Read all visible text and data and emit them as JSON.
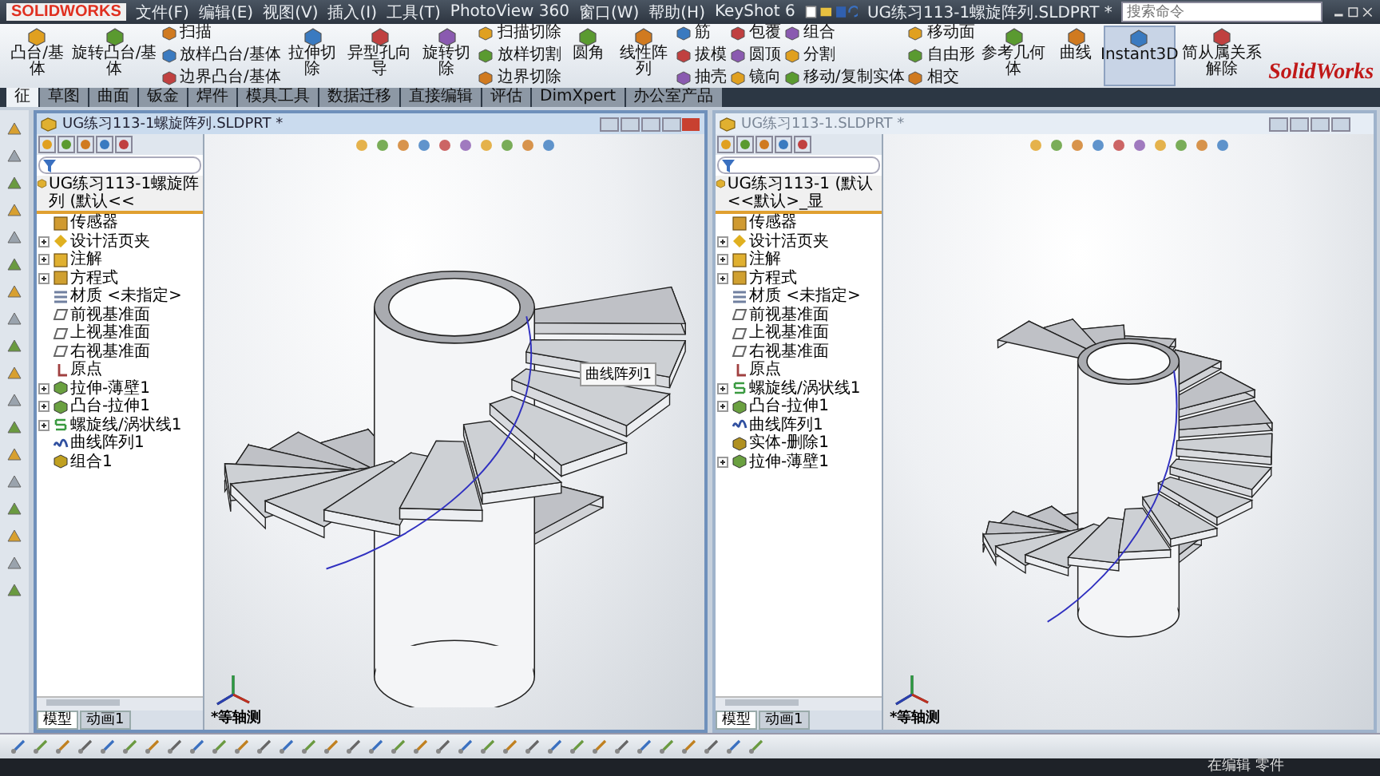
{
  "app": {
    "logo": "SOLIDWORKS",
    "title": "UG练习113-1螺旋阵列.SLDPRT *",
    "search_placeholder": "搜索命令",
    "brand": "SolidWorks"
  },
  "menu": [
    "文件(F)",
    "编辑(E)",
    "视图(V)",
    "插入(I)",
    "工具(T)",
    "PhotoView 360",
    "窗口(W)",
    "帮助(H)",
    "KeyShot 6"
  ],
  "ribbon": [
    {
      "kind": "large",
      "label": "凸台/基体"
    },
    {
      "kind": "large",
      "label": "旋转凸台/基体"
    },
    {
      "kind": "stack",
      "items": [
        "扫描",
        "放样凸台/基体",
        "边界凸台/基体"
      ]
    },
    {
      "kind": "large",
      "label": "拉伸切除"
    },
    {
      "kind": "large",
      "label": "异型孔向导"
    },
    {
      "kind": "large",
      "label": "旋转切除"
    },
    {
      "kind": "stack",
      "items": [
        "扫描切除",
        "放样切割",
        "边界切除"
      ]
    },
    {
      "kind": "large",
      "label": "圆角"
    },
    {
      "kind": "large",
      "label": "线性阵列"
    },
    {
      "kind": "stack",
      "items": [
        "筋",
        "拔模",
        "抽壳"
      ]
    },
    {
      "kind": "stack",
      "items": [
        "包覆",
        "圆顶",
        "镜向"
      ]
    },
    {
      "kind": "stack",
      "items": [
        "组合",
        "分割",
        "移动/复制实体"
      ]
    },
    {
      "kind": "stack",
      "items": [
        "移动面",
        "自由形",
        "相交"
      ]
    },
    {
      "kind": "large",
      "label": "参考几何体"
    },
    {
      "kind": "large",
      "label": "曲线"
    },
    {
      "kind": "large",
      "label": "Instant3D"
    },
    {
      "kind": "large",
      "label": "简从属关系解除"
    }
  ],
  "tabs": [
    {
      "label": "征",
      "selected": true
    },
    {
      "label": "草图",
      "selected": false
    },
    {
      "label": "曲面",
      "selected": false
    },
    {
      "label": "钣金",
      "selected": false
    },
    {
      "label": "焊件",
      "selected": false
    },
    {
      "label": "模具工具",
      "selected": false
    },
    {
      "label": "数据迁移",
      "selected": false
    },
    {
      "label": "直接编辑",
      "selected": false
    },
    {
      "label": "评估",
      "selected": false
    },
    {
      "label": "DimXpert",
      "selected": false
    },
    {
      "label": "办公室产品",
      "selected": false
    }
  ],
  "documents": [
    {
      "title": "UG练习113-1螺旋阵列.SLDPRT *",
      "active": true,
      "root": "UG练习113-1螺旋阵列 (默认<<",
      "tooltip": "曲线阵列1",
      "view_label": "*等轴测",
      "tree": [
        {
          "label": "传感器",
          "kind": "sensor",
          "collapsible": false
        },
        {
          "label": "设计活页夹",
          "kind": "binder",
          "collapsible": true
        },
        {
          "label": "注解",
          "kind": "annotation",
          "collapsible": true
        },
        {
          "label": "方程式",
          "kind": "equation",
          "collapsible": true
        },
        {
          "label": "材质 <未指定>",
          "kind": "material",
          "collapsible": false
        },
        {
          "label": "前视基准面",
          "kind": "plane",
          "collapsible": false
        },
        {
          "label": "上视基准面",
          "kind": "plane",
          "collapsible": false
        },
        {
          "label": "右视基准面",
          "kind": "plane",
          "collapsible": false
        },
        {
          "label": "原点",
          "kind": "origin",
          "collapsible": false
        },
        {
          "label": "拉伸-薄壁1",
          "kind": "feature",
          "collapsible": true
        },
        {
          "label": "凸台-拉伸1",
          "kind": "feature",
          "collapsible": true
        },
        {
          "label": "螺旋线/涡状线1",
          "kind": "helix",
          "collapsible": true
        },
        {
          "label": "曲线阵列1",
          "kind": "pattern",
          "collapsible": false
        },
        {
          "label": "组合1",
          "kind": "combine",
          "collapsible": false
        }
      ],
      "bottom_tabs": [
        {
          "label": "模型",
          "selected": true
        },
        {
          "label": "动画1",
          "selected": false
        }
      ]
    },
    {
      "title": "UG练习113-1.SLDPRT *",
      "active": false,
      "root": "UG练习113-1 (默认<<默认>_显",
      "view_label": "*等轴测",
      "tree": [
        {
          "label": "传感器",
          "kind": "sensor",
          "collapsible": false
        },
        {
          "label": "设计活页夹",
          "kind": "binder",
          "collapsible": true
        },
        {
          "label": "注解",
          "kind": "annotation",
          "collapsible": true
        },
        {
          "label": "方程式",
          "kind": "equation",
          "collapsible": true
        },
        {
          "label": "材质 <未指定>",
          "kind": "material",
          "collapsible": false
        },
        {
          "label": "前视基准面",
          "kind": "plane",
          "collapsible": false
        },
        {
          "label": "上视基准面",
          "kind": "plane",
          "collapsible": false
        },
        {
          "label": "右视基准面",
          "kind": "plane",
          "collapsible": false
        },
        {
          "label": "原点",
          "kind": "origin",
          "collapsible": false
        },
        {
          "label": "螺旋线/涡状线1",
          "kind": "helix",
          "collapsible": true
        },
        {
          "label": "凸台-拉伸1",
          "kind": "feature",
          "collapsible": true
        },
        {
          "label": "曲线阵列1",
          "kind": "pattern",
          "collapsible": false
        },
        {
          "label": "实体-删除1",
          "kind": "delete",
          "collapsible": false
        },
        {
          "label": "拉伸-薄壁1",
          "kind": "feature",
          "collapsible": true
        }
      ],
      "bottom_tabs": [
        {
          "label": "模型",
          "selected": true
        },
        {
          "label": "动画1",
          "selected": false
        }
      ]
    }
  ],
  "status": "在编辑 零件"
}
